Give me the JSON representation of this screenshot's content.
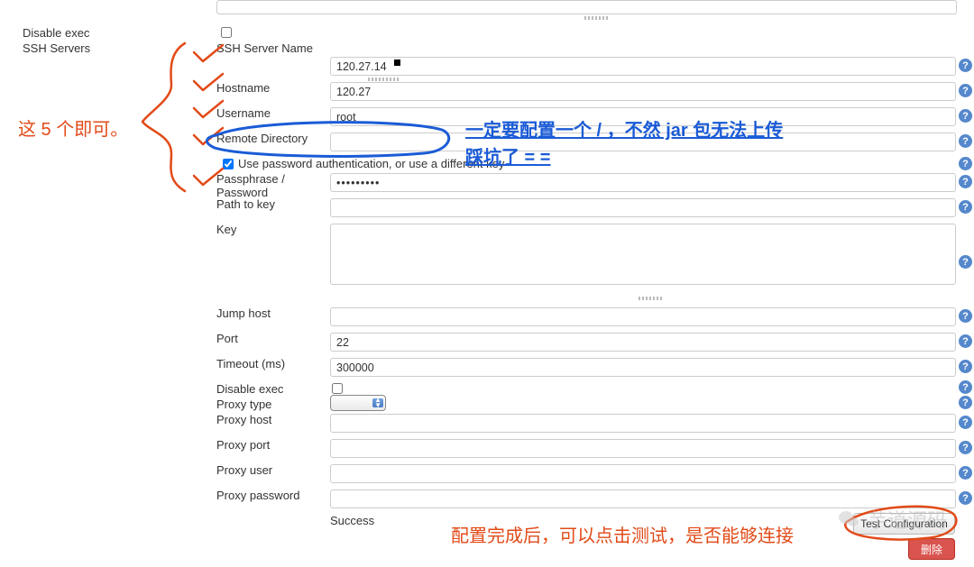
{
  "sidebar": {
    "disable_exec": "Disable exec",
    "ssh_servers": "SSH Servers"
  },
  "form": {
    "ssh_server_name": {
      "label": "SSH Server Name",
      "value": "120.27.14"
    },
    "hostname": {
      "label": "Hostname",
      "value": "120.27"
    },
    "username": {
      "label": "Username",
      "value": "root"
    },
    "remote_dir": {
      "label": "Remote Directory",
      "value": ""
    },
    "use_password": {
      "label": "Use password authentication, or use a different key",
      "checked": true
    },
    "passphrase": {
      "label": "Passphrase / Password",
      "value": "•••••••••"
    },
    "path_to_key": {
      "label": "Path to key",
      "value": ""
    },
    "key": {
      "label": "Key",
      "value": ""
    },
    "jump_host": {
      "label": "Jump host",
      "value": ""
    },
    "port": {
      "label": "Port",
      "value": "22"
    },
    "timeout": {
      "label": "Timeout (ms)",
      "value": "300000"
    },
    "inner_disable_exec": {
      "label": "Disable exec"
    },
    "proxy_type": {
      "label": "Proxy type",
      "value": ""
    },
    "proxy_host": {
      "label": "Proxy host",
      "value": ""
    },
    "proxy_port": {
      "label": "Proxy port",
      "value": ""
    },
    "proxy_user": {
      "label": "Proxy user",
      "value": ""
    },
    "proxy_password": {
      "label": "Proxy password",
      "value": ""
    }
  },
  "status": {
    "success": "Success"
  },
  "buttons": {
    "test": "Test Configuration",
    "delete": "删除"
  },
  "annotations": {
    "five_items": "这 5 个即可。",
    "remote_dir_note_l1": "一定要配置一个 / ，不然 jar 包无法上传",
    "remote_dir_note_l2": "踩坑了 = =",
    "test_note": "配置完成后，可以点击测试，是否能够连接"
  },
  "watermark": "芋道源码",
  "help_tooltip_char": "?"
}
